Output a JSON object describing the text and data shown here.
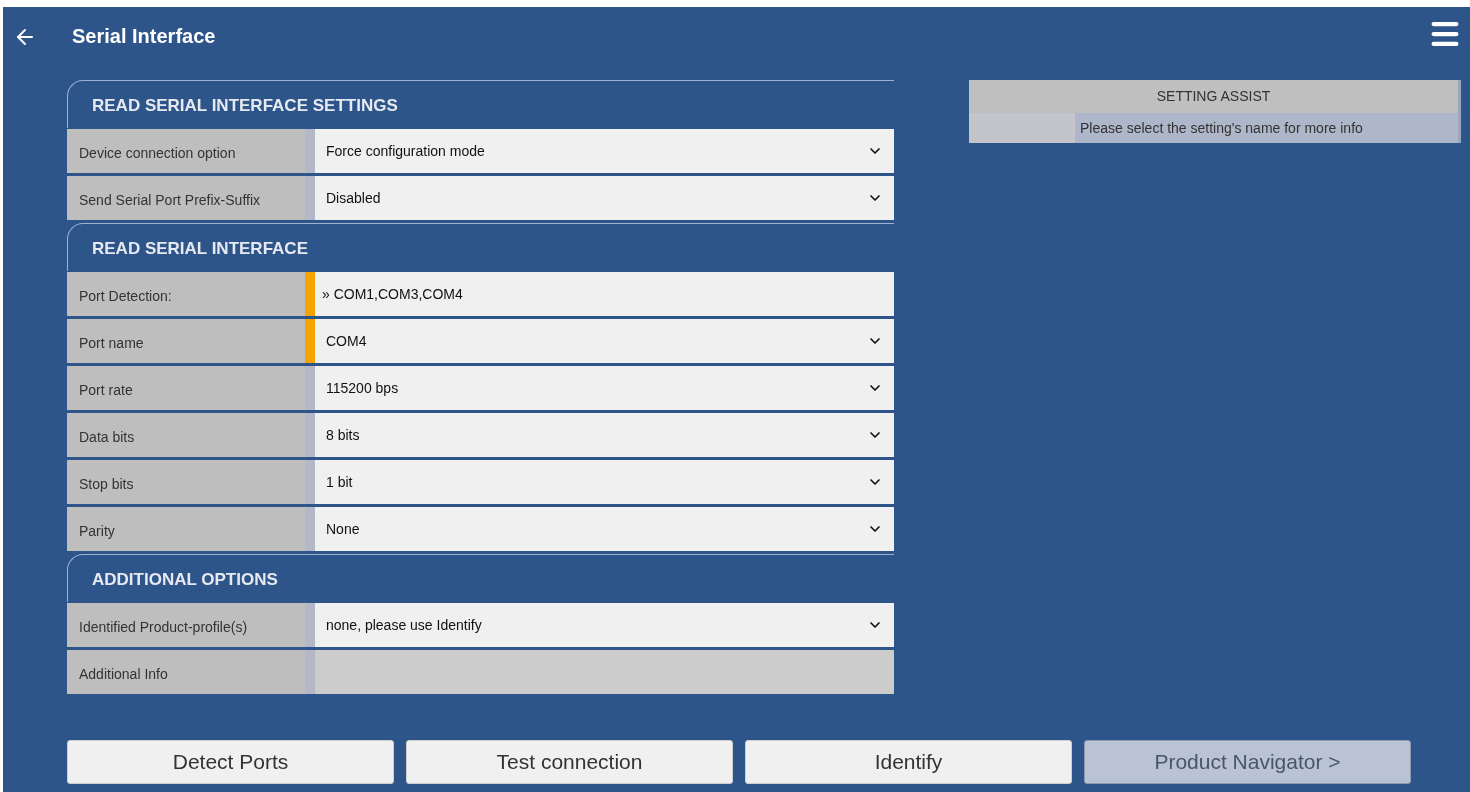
{
  "header": {
    "title": "Serial Interface"
  },
  "sections": [
    {
      "title": "READ SERIAL INTERFACE SETTINGS",
      "rows": [
        {
          "kind": "select",
          "label": "Device connection option",
          "value": "Force configuration mode",
          "highlighted": false
        },
        {
          "kind": "select",
          "label": "Send Serial Port Prefix-Suffix",
          "value": "Disabled",
          "highlighted": false
        }
      ]
    },
    {
      "title": "READ SERIAL INTERFACE",
      "rows": [
        {
          "kind": "text",
          "label": "Port Detection:",
          "value": "» COM1,COM3,COM4",
          "highlighted": true
        },
        {
          "kind": "select",
          "label": "Port name",
          "value": "COM4",
          "highlighted": true
        },
        {
          "kind": "select",
          "label": "Port rate",
          "value": "115200 bps",
          "highlighted": false
        },
        {
          "kind": "select",
          "label": "Data bits",
          "value": "8 bits",
          "highlighted": false
        },
        {
          "kind": "select",
          "label": "Stop bits",
          "value": "1 bit",
          "highlighted": false
        },
        {
          "kind": "select",
          "label": "Parity",
          "value": "None",
          "highlighted": false
        }
      ]
    },
    {
      "title": "ADDITIONAL OPTIONS",
      "rows": [
        {
          "kind": "select",
          "label": "Identified Product-profile(s)",
          "value": "none, please use Identify",
          "highlighted": false
        },
        {
          "kind": "empty",
          "label": "Additional Info",
          "highlighted": false
        }
      ]
    }
  ],
  "setting_assist": {
    "title": "SETTING ASSIST",
    "message": "Please select the setting's name for more info"
  },
  "buttons": [
    {
      "label": "Detect Ports",
      "disabled": false
    },
    {
      "label": "Test connection",
      "disabled": false
    },
    {
      "label": "Identify",
      "disabled": false
    },
    {
      "label": "Product Navigator >",
      "disabled": true
    }
  ]
}
